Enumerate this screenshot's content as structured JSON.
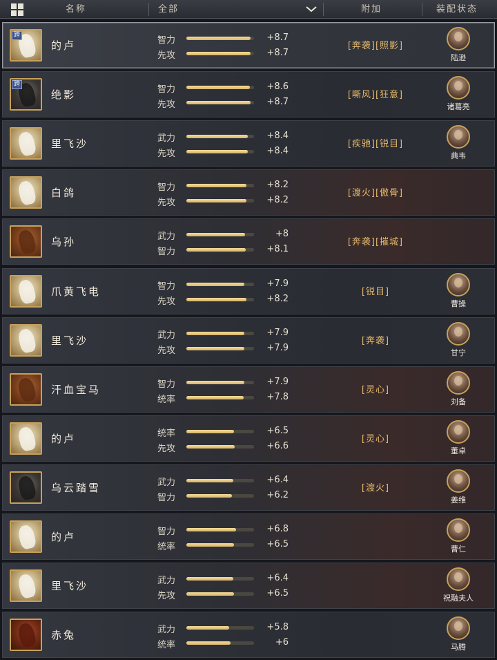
{
  "header": {
    "col_name": "名称",
    "col_filter": "全部",
    "col_extra": "附加",
    "col_equip": "装配状态",
    "layout_icon": "layout-grid-icon",
    "filter_icon": "chevron-down-icon"
  },
  "rows": [
    {
      "name": "的卢",
      "tag": "跨",
      "stat1": {
        "label": "智力",
        "value": "+8.7",
        "level": 8.7
      },
      "stat2": {
        "label": "先攻",
        "value": "+8.7",
        "level": 8.7
      },
      "extra": "[奔袭][照影]",
      "general": "陆逊"
    },
    {
      "name": "绝影",
      "tag": "跨",
      "stat1": {
        "label": "智力",
        "value": "+8.6",
        "level": 8.6
      },
      "stat2": {
        "label": "先攻",
        "value": "+8.7",
        "level": 8.7
      },
      "extra": "[嘶风][狂意]",
      "general": "诸葛亮"
    },
    {
      "name": "里飞沙",
      "tag": "",
      "stat1": {
        "label": "武力",
        "value": "+8.4",
        "level": 8.4
      },
      "stat2": {
        "label": "先攻",
        "value": "+8.4",
        "level": 8.4
      },
      "extra": "[疾驰][锐目]",
      "general": "典韦"
    },
    {
      "name": "白鸽",
      "tag": "",
      "stat1": {
        "label": "智力",
        "value": "+8.2",
        "level": 8.2
      },
      "stat2": {
        "label": "先攻",
        "value": "+8.2",
        "level": 8.2
      },
      "extra": "[渡火][傲骨]",
      "general": ""
    },
    {
      "name": "乌孙",
      "tag": "",
      "stat1": {
        "label": "武力",
        "value": "+8",
        "level": 8.0
      },
      "stat2": {
        "label": "智力",
        "value": "+8.1",
        "level": 8.1
      },
      "extra": "[奔袭][摧城]",
      "general": ""
    },
    {
      "name": "爪黄飞电",
      "tag": "",
      "stat1": {
        "label": "智力",
        "value": "+7.9",
        "level": 7.9
      },
      "stat2": {
        "label": "先攻",
        "value": "+8.2",
        "level": 8.2
      },
      "extra": "[锐目]",
      "general": "曹操"
    },
    {
      "name": "里飞沙",
      "tag": "",
      "stat1": {
        "label": "武力",
        "value": "+7.9",
        "level": 7.9
      },
      "stat2": {
        "label": "先攻",
        "value": "+7.9",
        "level": 7.9
      },
      "extra": "[奔袭]",
      "general": "甘宁"
    },
    {
      "name": "汗血宝马",
      "tag": "",
      "stat1": {
        "label": "智力",
        "value": "+7.9",
        "level": 7.9
      },
      "stat2": {
        "label": "统率",
        "value": "+7.8",
        "level": 7.8
      },
      "extra": "[灵心]",
      "general": "刘备"
    },
    {
      "name": "的卢",
      "tag": "",
      "stat1": {
        "label": "统率",
        "value": "+6.5",
        "level": 6.5
      },
      "stat2": {
        "label": "先攻",
        "value": "+6.6",
        "level": 6.6
      },
      "extra": "[灵心]",
      "general": "董卓"
    },
    {
      "name": "乌云踏雪",
      "tag": "",
      "stat1": {
        "label": "武力",
        "value": "+6.4",
        "level": 6.4
      },
      "stat2": {
        "label": "智力",
        "value": "+6.2",
        "level": 6.2
      },
      "extra": "[渡火]",
      "general": "姜维"
    },
    {
      "name": "的卢",
      "tag": "",
      "stat1": {
        "label": "智力",
        "value": "+6.8",
        "level": 6.8
      },
      "stat2": {
        "label": "统率",
        "value": "+6.5",
        "level": 6.5
      },
      "extra": "",
      "general": "曹仁"
    },
    {
      "name": "里飞沙",
      "tag": "",
      "stat1": {
        "label": "武力",
        "value": "+6.4",
        "level": 6.4
      },
      "stat2": {
        "label": "先攻",
        "value": "+6.5",
        "level": 6.5
      },
      "extra": "",
      "general": "祝融夫人"
    },
    {
      "name": "赤兔",
      "tag": "",
      "stat1": {
        "label": "武力",
        "value": "+5.8",
        "level": 5.8
      },
      "stat2": {
        "label": "统率",
        "value": "+6",
        "level": 6.0
      },
      "extra": "",
      "general": "马腾"
    }
  ],
  "stat_max": 9.2
}
